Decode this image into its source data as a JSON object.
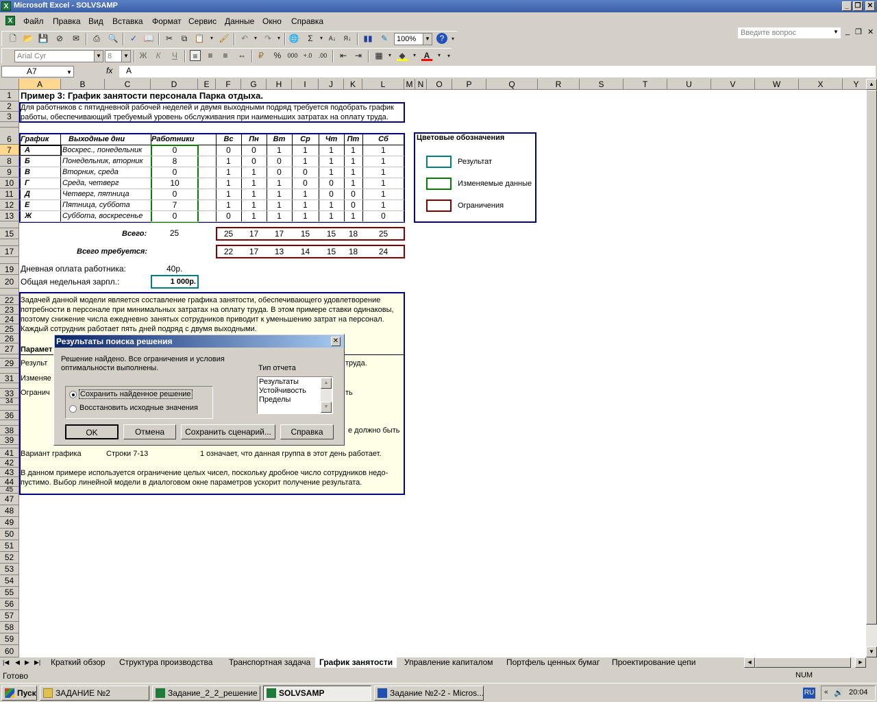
{
  "window": {
    "title": "Microsoft Excel - SOLVSAMP"
  },
  "menu": [
    "Файл",
    "Правка",
    "Вид",
    "Вставка",
    "Формат",
    "Сервис",
    "Данные",
    "Окно",
    "Справка"
  ],
  "help_placeholder": "Введите вопрос",
  "toolbar": {
    "zoom": "100%",
    "font": "Arial Cyr",
    "font_size": "8",
    "bold": "Ж",
    "italic": "К",
    "underline": "Ч",
    "percent": "%",
    "thousands": "000"
  },
  "formula": {
    "namebox": "A7",
    "fx": "fx",
    "value": "A"
  },
  "columns": [
    "A",
    "B",
    "C",
    "D",
    "E",
    "F",
    "G",
    "H",
    "I",
    "J",
    "K",
    "L",
    "M",
    "N",
    "O",
    "P",
    "Q",
    "R",
    "S",
    "T",
    "U",
    "V",
    "W",
    "X",
    "Y"
  ],
  "rows": [
    "1",
    "2",
    "3",
    "6",
    "7",
    "8",
    "9",
    "10",
    "11",
    "12",
    "13",
    "15",
    "17",
    "19",
    "20",
    "22",
    "23",
    "24",
    "25",
    "26",
    "27",
    "29",
    "31",
    "33",
    "34",
    "36",
    "38",
    "39",
    "41",
    "42",
    "43",
    "44",
    "45",
    "47",
    "48",
    "49",
    "50",
    "51",
    "52",
    "53",
    "54",
    "55",
    "56",
    "57",
    "58",
    "59",
    "60"
  ],
  "sheet": {
    "title": "Пример 3:  График занятости персонала Парка отдыха.",
    "desc1": "Для работников с пятидневной рабочей неделей и двумя выходными подряд требуется подобрать график",
    "desc2": "работы, обеспечивающий требуемый уровень обслуживания при наименьших затратах на оплату труда.",
    "headers": {
      "schedule": "График",
      "daysoff": "Выходные дни",
      "workers": "Работники",
      "days": [
        "Вс",
        "Пн",
        "Вт",
        "Ср",
        "Чт",
        "Пт",
        "Сб"
      ]
    },
    "table": [
      {
        "code": "А",
        "off": "Воскрес., понедельник",
        "w": "0",
        "d": [
          "0",
          "0",
          "1",
          "1",
          "1",
          "1",
          "1"
        ]
      },
      {
        "code": "Б",
        "off": "Понедельник, вторник",
        "w": "8",
        "d": [
          "1",
          "0",
          "0",
          "1",
          "1",
          "1",
          "1"
        ]
      },
      {
        "code": "В",
        "off": "Вторник, среда",
        "w": "0",
        "d": [
          "1",
          "1",
          "0",
          "0",
          "1",
          "1",
          "1"
        ]
      },
      {
        "code": "Г",
        "off": "Среда, четверг",
        "w": "10",
        "d": [
          "1",
          "1",
          "1",
          "0",
          "0",
          "1",
          "1"
        ]
      },
      {
        "code": "Д",
        "off": "Четверг, пятница",
        "w": "0",
        "d": [
          "1",
          "1",
          "1",
          "1",
          "0",
          "0",
          "1"
        ]
      },
      {
        "code": "Е",
        "off": "Пятница, суббота",
        "w": "7",
        "d": [
          "1",
          "1",
          "1",
          "1",
          "1",
          "0",
          "1"
        ]
      },
      {
        "code": "Ж",
        "off": "Суббота, воскресенье",
        "w": "0",
        "d": [
          "0",
          "1",
          "1",
          "1",
          "1",
          "1",
          "0"
        ]
      }
    ],
    "total_label": "Всего:",
    "total_workers": "25",
    "totals": [
      "25",
      "17",
      "17",
      "15",
      "15",
      "18",
      "25"
    ],
    "required_label": "Всего требуется:",
    "required": [
      "22",
      "17",
      "13",
      "14",
      "15",
      "18",
      "24"
    ],
    "pay_label": "Дневная оплата работника:",
    "pay": "40р.",
    "salary_label": "Общая недельная зарпл.:",
    "salary": "1 000р.",
    "legend": {
      "title": "Цветовые обозначения",
      "result": "Результат",
      "changing": "Изменяемые данные",
      "constraints": "Ограничения"
    },
    "notes": [
      "Задачей данной модели является составление графика занятости, обеспечивающего удовлетворение",
      "потребности в персонале при минимальных затратах на оплату труда. В этом примере ставки одинаковы,",
      "поэтому снижение числа ежедневно занятых сотрудников приводит к уменьшению затрат на персонал.",
      "Каждый сотрудник работает пять дней подряд с двумя выходными."
    ],
    "params_label": "Парамет",
    "r29a": "Результ",
    "r29b": "труда.",
    "r31": "Изменяе",
    "r33a": "Огранич",
    "r33b": "ть",
    "r38": "е должно быть",
    "r41a": "Вариант графика",
    "r41b": "Строки 7-13",
    "r41c": "1 означает, что данная группа в этот день работает.",
    "r43": "В данном примере используется ограничение целых чисел, поскольку дробное число сотрудников недо-",
    "r44": "пустимо.  Выбор линейной модели в диалоговом окне параметров ускорит получение результата."
  },
  "dialog": {
    "title": "Результаты поиска решения",
    "msg1": "Решение найдено. Все ограничения и условия",
    "msg2": "оптимальности выполнены.",
    "keep": "Сохранить найденное решение",
    "restore": "Восстановить исходные значения",
    "report_type": "Тип отчета",
    "reports": [
      "Результаты",
      "Устойчивость",
      "Пределы"
    ],
    "ok": "OK",
    "cancel": "Отмена",
    "save_scenario": "Сохранить сценарий...",
    "help": "Справка"
  },
  "tabs": [
    "Краткий обзор",
    "Структура производства",
    "Транспортная задача",
    "График занятости",
    "Управление капиталом",
    "Портфель ценных бумаг",
    "Проектирование цепи"
  ],
  "status": {
    "ready": "Готово",
    "num": "NUM"
  },
  "taskbar": {
    "start": "Пуск",
    "items": [
      "ЗАДАНИЕ №2",
      "Задание_2_2_решение",
      "SOLVSAMP",
      "Задание №2-2 - Micros..."
    ],
    "lang": "RU",
    "time": "20:04"
  }
}
